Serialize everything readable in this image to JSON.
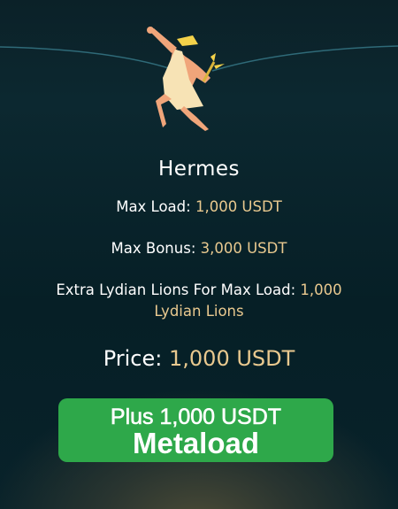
{
  "card": {
    "name": "Hermes",
    "max_load_label": "Max Load:",
    "max_load_value": "1,000 USDT",
    "max_bonus_label": "Max Bonus:",
    "max_bonus_value": "3,000 USDT",
    "extra_label": "Extra Lydian Lions For Max Load:",
    "extra_value_1": "1,000",
    "extra_value_2": "Lydian Lions",
    "price_label": "Price:",
    "price_value": "1,000 USDT"
  },
  "button": {
    "line1": "Plus 1,000 USDT",
    "line2": "Metaload"
  },
  "colors": {
    "accent_gold": "#e9c98f",
    "button_green": "#2ea84a"
  }
}
